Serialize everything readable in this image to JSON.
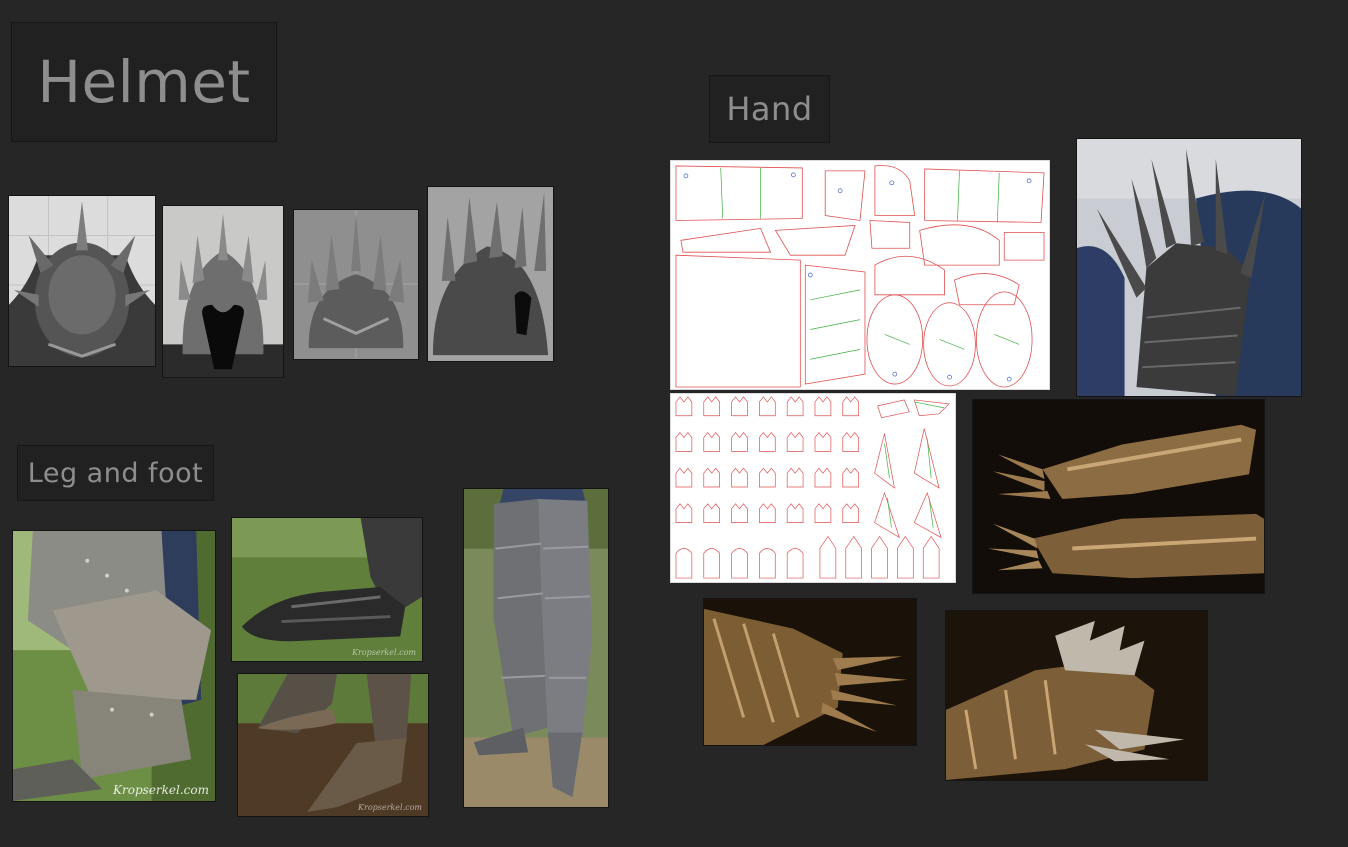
{
  "sections": {
    "helmet": {
      "title": "Helmet"
    },
    "hand": {
      "title": "Hand"
    },
    "leg": {
      "title": "Leg and foot"
    }
  },
  "photos": {
    "helmet": [
      {
        "name": "helmet-top-view"
      },
      {
        "name": "helmet-front-view"
      },
      {
        "name": "helmet-back-view"
      },
      {
        "name": "helmet-side-view"
      }
    ],
    "hand": [
      {
        "name": "gauntlet-pattern-sheet-1"
      },
      {
        "name": "gauntlet-worn-photo"
      },
      {
        "name": "gauntlet-pattern-sheet-2"
      },
      {
        "name": "gauntlets-pair-photo"
      },
      {
        "name": "gauntlet-closeup-1"
      },
      {
        "name": "gauntlet-closeup-2"
      }
    ],
    "leg": [
      {
        "name": "knee-armor-photo",
        "watermark": "Kropserkel.com"
      },
      {
        "name": "sabaton-grass-photo",
        "watermark": "Kropserkel.com"
      },
      {
        "name": "sabaton-dirt-photo",
        "watermark": "Kropserkel.com"
      },
      {
        "name": "leg-armor-full-photo"
      }
    ]
  }
}
